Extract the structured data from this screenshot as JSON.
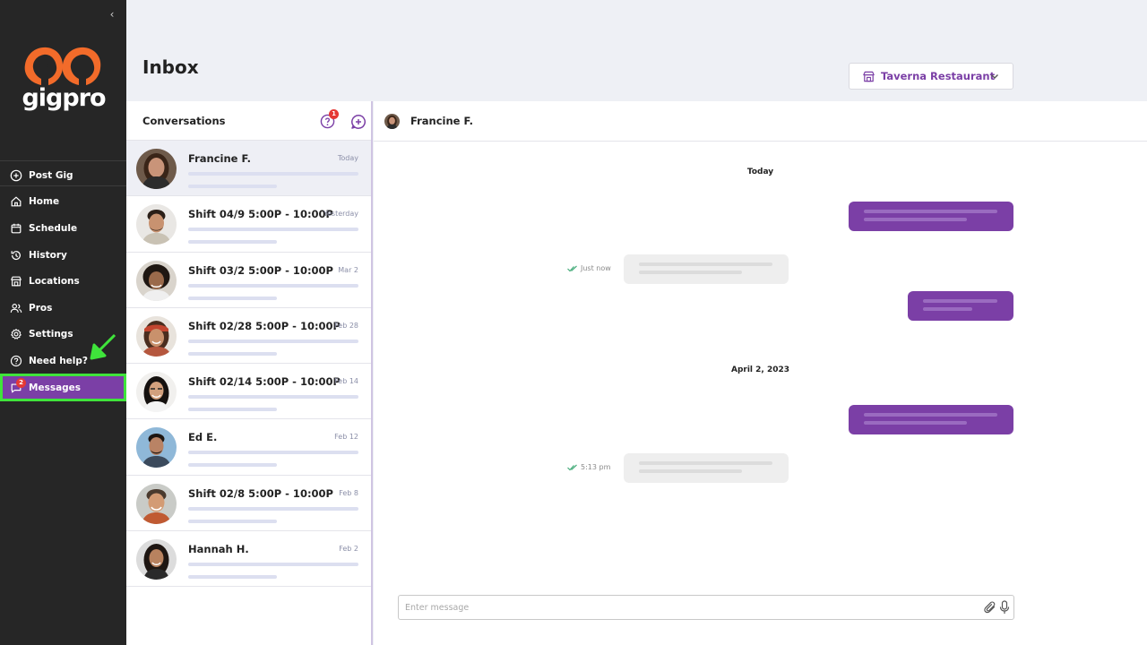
{
  "sidebar": {
    "collapse_icon": "chevron-left-icon",
    "logo_text": "gigpro",
    "nav_items": [
      {
        "label": "Post Gig",
        "icon": "plus-circle-icon"
      },
      {
        "label": "Home",
        "icon": "home-icon"
      },
      {
        "label": "Schedule",
        "icon": "calendar-icon"
      },
      {
        "label": "History",
        "icon": "history-icon"
      },
      {
        "label": "Locations",
        "icon": "store-icon"
      },
      {
        "label": "Pros",
        "icon": "users-icon"
      },
      {
        "label": "Settings",
        "icon": "gear-icon"
      },
      {
        "label": "Need help?",
        "icon": "help-circle-icon"
      },
      {
        "label": "Messages",
        "icon": "chat-icon",
        "badge": "2",
        "active": true
      }
    ]
  },
  "header": {
    "title": "Inbox",
    "restaurant_select": {
      "value": "Taverna Restaurant",
      "icon": "store-icon"
    }
  },
  "conversations": {
    "title": "Conversations",
    "help_badge": "1",
    "items": [
      {
        "name": "Francine F.",
        "date": "Today",
        "selected": true
      },
      {
        "name": "Shift 04/9 5:00P - 10:00P",
        "date": "Yesterday"
      },
      {
        "name": "Shift 03/2 5:00P - 10:00P",
        "date": "Mar 2"
      },
      {
        "name": "Shift 02/28 5:00P - 10:00P",
        "date": "Feb 28"
      },
      {
        "name": "Shift 02/14 5:00P - 10:00P",
        "date": "Feb 14"
      },
      {
        "name": "Ed E.",
        "date": "Feb 12"
      },
      {
        "name": "Shift 02/8 5:00P - 10:00P",
        "date": "Feb 8"
      },
      {
        "name": "Hannah H.",
        "date": "Feb 2"
      }
    ]
  },
  "chat": {
    "contact_name": "Francine F.",
    "groups": [
      {
        "date_label": "Today",
        "status": "Just now"
      },
      {
        "date_label": "April 2, 2023",
        "status": "5:13 pm"
      }
    ],
    "composer": {
      "placeholder": "Enter message"
    }
  },
  "colors": {
    "brand_purple": "#7b3fa6",
    "logo_orange": "#f26b2a",
    "sidebar_bg": "#262626",
    "highlight_green": "#3fe43b",
    "badge_red": "#e53935"
  }
}
